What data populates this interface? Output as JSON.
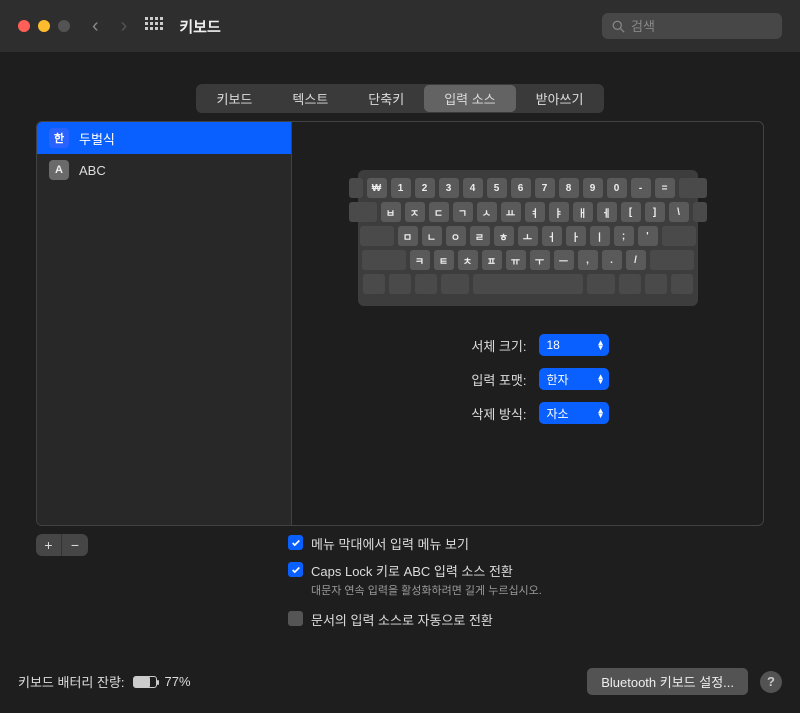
{
  "window": {
    "title": "키보드"
  },
  "search": {
    "placeholder": "검색"
  },
  "tabs": [
    "키보드",
    "텍스트",
    "단축키",
    "입력 소스",
    "받아쓰기"
  ],
  "active_tab": 3,
  "sources": [
    {
      "badge": "한",
      "label": "두벌식",
      "selected": true
    },
    {
      "badge": "A",
      "label": "ABC",
      "selected": false
    }
  ],
  "keyboard_rows": [
    [
      "₩",
      "1",
      "2",
      "3",
      "4",
      "5",
      "6",
      "7",
      "8",
      "9",
      "0",
      "-",
      "="
    ],
    [
      "ㅂ",
      "ㅈ",
      "ㄷ",
      "ㄱ",
      "ㅅ",
      "ㅛ",
      "ㅕ",
      "ㅑ",
      "ㅐ",
      "ㅔ",
      "[",
      "]",
      "\\"
    ],
    [
      "ㅁ",
      "ㄴ",
      "ㅇ",
      "ㄹ",
      "ㅎ",
      "ㅗ",
      "ㅓ",
      "ㅏ",
      "ㅣ",
      ";",
      "'"
    ],
    [
      "ㅋ",
      "ㅌ",
      "ㅊ",
      "ㅍ",
      "ㅠ",
      "ㅜ",
      "ㅡ",
      ",",
      ".",
      "/"
    ]
  ],
  "form": {
    "font_size": {
      "label": "서체 크기:",
      "value": "18"
    },
    "input_format": {
      "label": "입력 포맷:",
      "value": "한자"
    },
    "delete_mode": {
      "label": "삭제 방식:",
      "value": "자소"
    }
  },
  "buttons": {
    "add": "+",
    "remove": "−"
  },
  "checkboxes": {
    "show_menu": {
      "label": "메뉴 막대에서 입력 메뉴 보기",
      "checked": true
    },
    "caps_lock": {
      "label": "Caps Lock 키로 ABC 입력 소스 전환",
      "checked": true,
      "hint": "대문자 연속 입력을 활성화하려면 길게 누르십시오."
    },
    "auto_switch": {
      "label": "문서의 입력 소스로 자동으로 전환",
      "checked": false
    }
  },
  "footer": {
    "battery_label": "키보드 배터리 잔량:",
    "battery_pct": "77%",
    "battery_fill": 77,
    "bluetooth_btn": "Bluetooth 키보드 설정...",
    "help": "?"
  }
}
